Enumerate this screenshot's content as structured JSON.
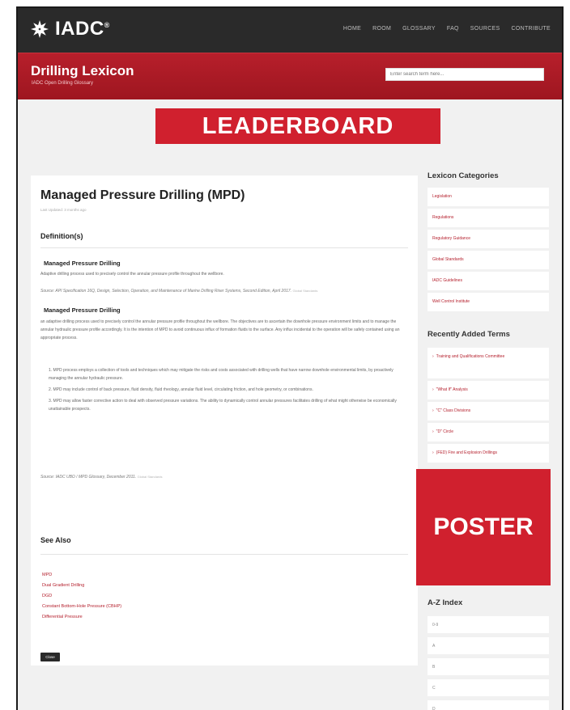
{
  "header": {
    "logo_text": "IADC",
    "nav": [
      "HOME",
      "ROOM",
      "GLOSSARY",
      "FAQ",
      "SOURCES",
      "CONTRIBUTE"
    ]
  },
  "subheader": {
    "title": "Drilling Lexicon",
    "subtitle": "IADC Open Drilling Glossary",
    "search_placeholder": "Enter search term here..."
  },
  "ads": {
    "leaderboard": "LEADERBOARD",
    "poster": "POSTER"
  },
  "article": {
    "title": "Managed Pressure Drilling (MPD)",
    "updated": "Last Updated: 3 months ago",
    "definitions_heading": "Definition(s)",
    "definitions": [
      {
        "title": "Managed Pressure Drilling",
        "text": "Adaptive drilling process used to precisely control the annular pressure profile throughout the wellbore.",
        "source": "Source: API Specification 16Q, Design, Selection, Operation, and Maintenance of Marine Drilling Riser Systems, Second Edition, April 2017.",
        "source_tag": "Global Standards"
      },
      {
        "title": "Managed Pressure Drilling",
        "text": "an adaptive drilling process used to precisely control the annular pressure profile throughout the wellbore. The objectives are to ascertain the downhole pressure environment limits and to manage the annular hydraulic pressure profile accordingly. It is the intention of MPD to avoid continuous influx of formation fluids to the surface. Any influx incidental to the operation will be safely contained using an appropriate process.",
        "items": [
          "1. MPD process employs a collection of tools and techniques which may mitigate the risks and costs associated with drilling wells that have narrow downhole environmental limits, by proactively managing the annular hydraulic pressure.",
          "2. MPD may include control of back pressure, fluid density, fluid rheology, annular fluid level, circulating friction, and hole geometry, or combinations.",
          "3. MPD may allow faster corrective action to deal with observed pressure variations. The ability to dynamically control annular pressures facilitates drilling of what might otherwise be economically unattainable prospects."
        ],
        "source": "Source: IADC UBO / MPD Glossary, December 2011.",
        "source_tag": "Global Standards"
      }
    ],
    "see_also_heading": "See Also",
    "see_also": [
      "MPD",
      "Dual Gradient Drilling",
      "DGD",
      "Constant Bottom-Hole Pressure (CBHP)",
      "Differential Pressure"
    ],
    "close_label": "Close"
  },
  "sidebar": {
    "categories_heading": "Lexicon Categories",
    "categories": [
      "Legislation",
      "Regulations",
      "Regulatory Guidance",
      "Global Standards",
      "IADC Guidelines",
      "Well Control Institute"
    ],
    "recent_heading": "Recently Added Terms",
    "recent": [
      "Training and Qualifications Committee",
      "\"What If\" Analysis",
      "\"C\" Class Divisions",
      "\"D\" Circle",
      "(FED) Fire and Explosion Drillings"
    ],
    "az_heading": "A-Z Index",
    "az": [
      "0-9",
      "A",
      "B",
      "C",
      "D"
    ]
  }
}
